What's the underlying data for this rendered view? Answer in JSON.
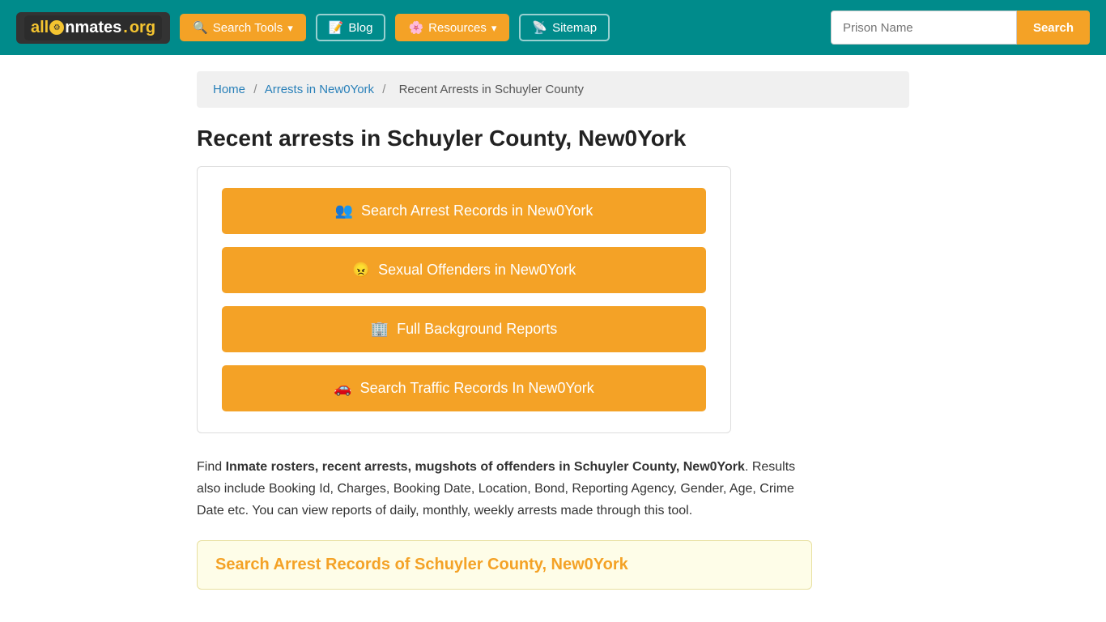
{
  "header": {
    "logo_all": "all",
    "logo_inmates": "mates",
    "logo_dot": ".",
    "logo_org": "org",
    "nav": {
      "search_tools": "Search Tools",
      "blog": "Blog",
      "resources": "Resources",
      "sitemap": "Sitemap"
    },
    "prison_placeholder": "Prison Name",
    "search_btn": "Search"
  },
  "breadcrumb": {
    "home": "Home",
    "arrests": "Arrests in New0York",
    "current": "Recent Arrests in Schuyler County"
  },
  "page_title": "Recent arrests in Schuyler County, New0York",
  "action_buttons": {
    "arrest_records": "Search Arrest Records in New0York",
    "sexual_offenders": "Sexual Offenders in New0York",
    "background_reports": "Full Background Reports",
    "traffic_records": "Search Traffic Records In New0York"
  },
  "description": {
    "prefix": "Find ",
    "bold1": "Inmate rosters, recent arrests, mugshots of offenders in Schuyler County, New0York",
    "suffix": ". Results also include Booking Id, Charges, Booking Date, Location, Bond, Reporting Agency, Gender, Age, Crime Date etc. You can view reports of daily, monthly, weekly arrests made through this tool."
  },
  "search_section": {
    "title": "Search Arrest Records of Schuyler County, New0York"
  }
}
